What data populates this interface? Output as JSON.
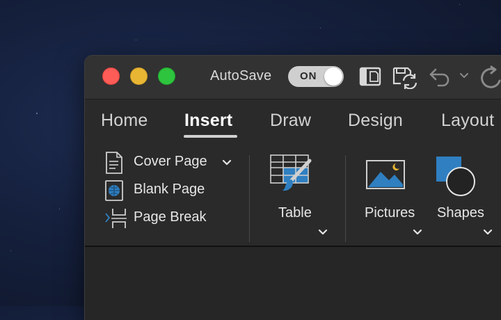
{
  "titlebar": {
    "autosave_label": "AutoSave",
    "autosave_state": "ON",
    "icons": [
      "sidebar-doc-icon",
      "save-sync-icon",
      "undo-icon",
      "undo-dropdown-icon",
      "redo-icon"
    ]
  },
  "tabs": [
    {
      "label": "Home",
      "active": false
    },
    {
      "label": "Insert",
      "active": true
    },
    {
      "label": "Draw",
      "active": false
    },
    {
      "label": "Design",
      "active": false
    },
    {
      "label": "Layout",
      "active": false
    }
  ],
  "pages_group": {
    "items": [
      {
        "label": "Cover Page",
        "icon": "cover-page-icon",
        "has_dropdown": true
      },
      {
        "label": "Blank Page",
        "icon": "blank-page-icon",
        "has_dropdown": false
      },
      {
        "label": "Page Break",
        "icon": "page-break-icon",
        "has_dropdown": false
      }
    ]
  },
  "table_group": {
    "label": "Table",
    "icon": "table-icon"
  },
  "illustrations_group": {
    "pictures_label": "Pictures",
    "shapes_label": "Shapes"
  },
  "colors": {
    "accent_blue": "#2f7fc1",
    "tab_underline": "#d0d0d0",
    "close": "#fd5c57",
    "minimize": "#e9b634",
    "zoom": "#2ec43e"
  }
}
